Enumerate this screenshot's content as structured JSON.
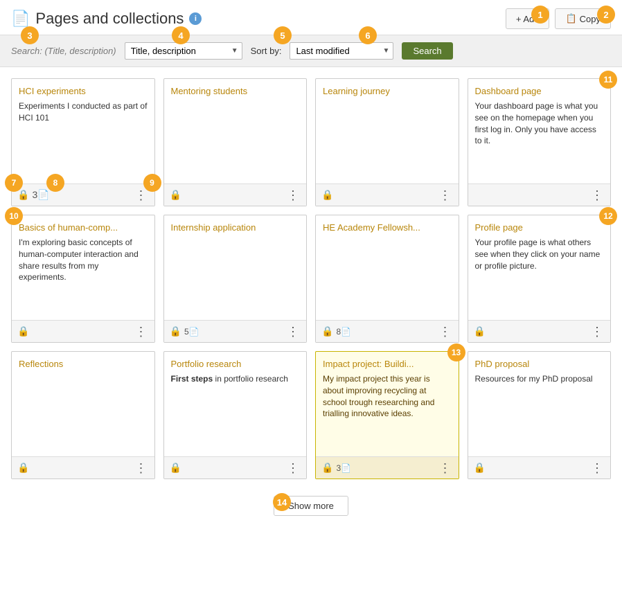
{
  "page": {
    "title": "Pages and collections",
    "icon": "📄"
  },
  "header": {
    "info_label": "i",
    "add_label": "+ Add",
    "copy_label": "Copy",
    "badge1": "1",
    "badge2": "2"
  },
  "searchbar": {
    "search_label": "Search:",
    "search_hint": "(Title, description)",
    "input_placeholder": "Title, description",
    "sort_label": "Sort by:",
    "sort_value": "Last modified",
    "search_btn": "Search",
    "badge3": "3",
    "badge4": "4",
    "badge5": "5",
    "badge6": "6"
  },
  "cards": [
    {
      "id": "hci-experiments",
      "title": "HCI experiments",
      "description": "Experiments I conducted as part of HCI 101",
      "locked": true,
      "collection_count": "3",
      "has_collection": true,
      "badge": "7",
      "badge_pos": "lock",
      "badge8": "8",
      "badge8_pos": "collection",
      "badge9": "9",
      "badge9_pos": "more",
      "highlighted": false
    },
    {
      "id": "mentoring-students",
      "title": "Mentoring students",
      "description": "",
      "locked": true,
      "collection_count": null,
      "has_collection": false,
      "highlighted": false
    },
    {
      "id": "learning-journey",
      "title": "Learning journey",
      "description": "",
      "locked": true,
      "collection_count": null,
      "has_collection": false,
      "highlighted": false
    },
    {
      "id": "dashboard-page",
      "title": "Dashboard page",
      "description": "Your dashboard page is what you see on the homepage when you first log in. Only you have access to it.",
      "locked": false,
      "collection_count": null,
      "has_collection": false,
      "highlighted": false,
      "badge11": "11"
    },
    {
      "id": "basics-human-comp",
      "title": "Basics of human-comp...",
      "description": "I'm exploring basic concepts of human-computer interaction and share results from my experiments.",
      "locked": true,
      "collection_count": null,
      "has_collection": false,
      "highlighted": false,
      "badge10": "10"
    },
    {
      "id": "internship-application",
      "title": "Internship application",
      "description": "",
      "locked": true,
      "collection_count": "5",
      "has_collection": true,
      "highlighted": false
    },
    {
      "id": "he-academy",
      "title": "HE Academy Fellowsh...",
      "description": "",
      "locked": true,
      "collection_count": "8",
      "has_collection": true,
      "highlighted": false
    },
    {
      "id": "profile-page",
      "title": "Profile page",
      "description": "Your profile page is what others see when they click on your name or profile picture.",
      "locked": true,
      "collection_count": null,
      "has_collection": false,
      "highlighted": false,
      "badge12": "12"
    },
    {
      "id": "reflections",
      "title": "Reflections",
      "description": "",
      "locked": true,
      "collection_count": null,
      "has_collection": false,
      "highlighted": false
    },
    {
      "id": "portfolio-research",
      "title": "Portfolio research",
      "description": "First steps in portfolio research",
      "locked": true,
      "collection_count": null,
      "has_collection": false,
      "highlighted": false
    },
    {
      "id": "impact-project",
      "title": "Impact project: Buildi...",
      "description": "My impact project this year is about improving recycling at school trough researching and trialling innovative ideas.",
      "locked": true,
      "collection_count": "3",
      "has_collection": true,
      "highlighted": true,
      "badge13": "13"
    },
    {
      "id": "phd-proposal",
      "title": "PhD proposal",
      "description": "Resources for my PhD proposal",
      "locked": true,
      "collection_count": null,
      "has_collection": false,
      "highlighted": false
    }
  ],
  "footer": {
    "show_more": "Show more",
    "badge14": "14"
  }
}
